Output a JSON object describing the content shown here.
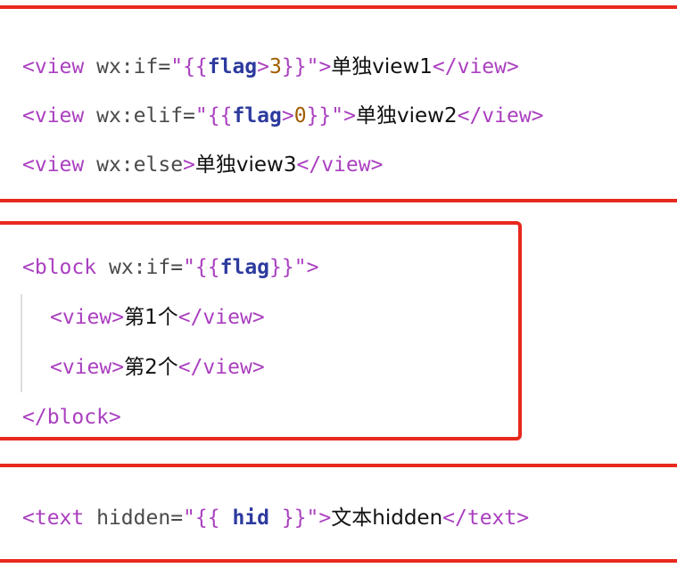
{
  "lines": {
    "l1": {
      "open_lt": "<",
      "tag": "view",
      "sp": " ",
      "attr": "wx:if=",
      "q1": "\"",
      "ob": "{{",
      "var": "flag",
      "op": ">",
      "num": "3",
      "cb": "}}",
      "q2": "\"",
      "gt": ">",
      "text": "单独view1",
      "close": "</view>"
    },
    "l2": {
      "open_lt": "<",
      "tag": "view",
      "sp": " ",
      "attr": "wx:elif=",
      "q1": "\"",
      "ob": "{{",
      "var": "flag",
      "op": ">",
      "num": "0",
      "cb": "}}",
      "q2": "\"",
      "gt": ">",
      "text": "单独view2",
      "close": "</view>"
    },
    "l3": {
      "open_lt": "<",
      "tag": "view",
      "sp": " ",
      "attr": "wx:else",
      "gt": ">",
      "text": "单独view3",
      "close": "</view>"
    },
    "l4": {
      "open_lt": "<",
      "tag": "block",
      "sp": " ",
      "attr": "wx:if=",
      "q1": "\"",
      "ob": "{{",
      "var": "flag",
      "cb": "}}",
      "q2": "\"",
      "gt": ">"
    },
    "l5": {
      "open": "<view>",
      "text": "第1个",
      "close": "</view>"
    },
    "l6": {
      "open": "<view>",
      "text": "第2个",
      "close": "</view>"
    },
    "l7": {
      "close": "</block>"
    },
    "l8": {
      "open_lt": "<",
      "tag": "text",
      "sp": " ",
      "attr": "hidden=",
      "q1": "\"",
      "ob": "{{ ",
      "var": "hid",
      "cb": " }}",
      "q2": "\"",
      "gt": ">",
      "text": "文本hidden",
      "close": "</text>"
    }
  },
  "colors": {
    "highlight_border": "#e8291f",
    "tag": "#aa3fbf",
    "variable": "#2d3a9e",
    "number": "#a15c00"
  }
}
